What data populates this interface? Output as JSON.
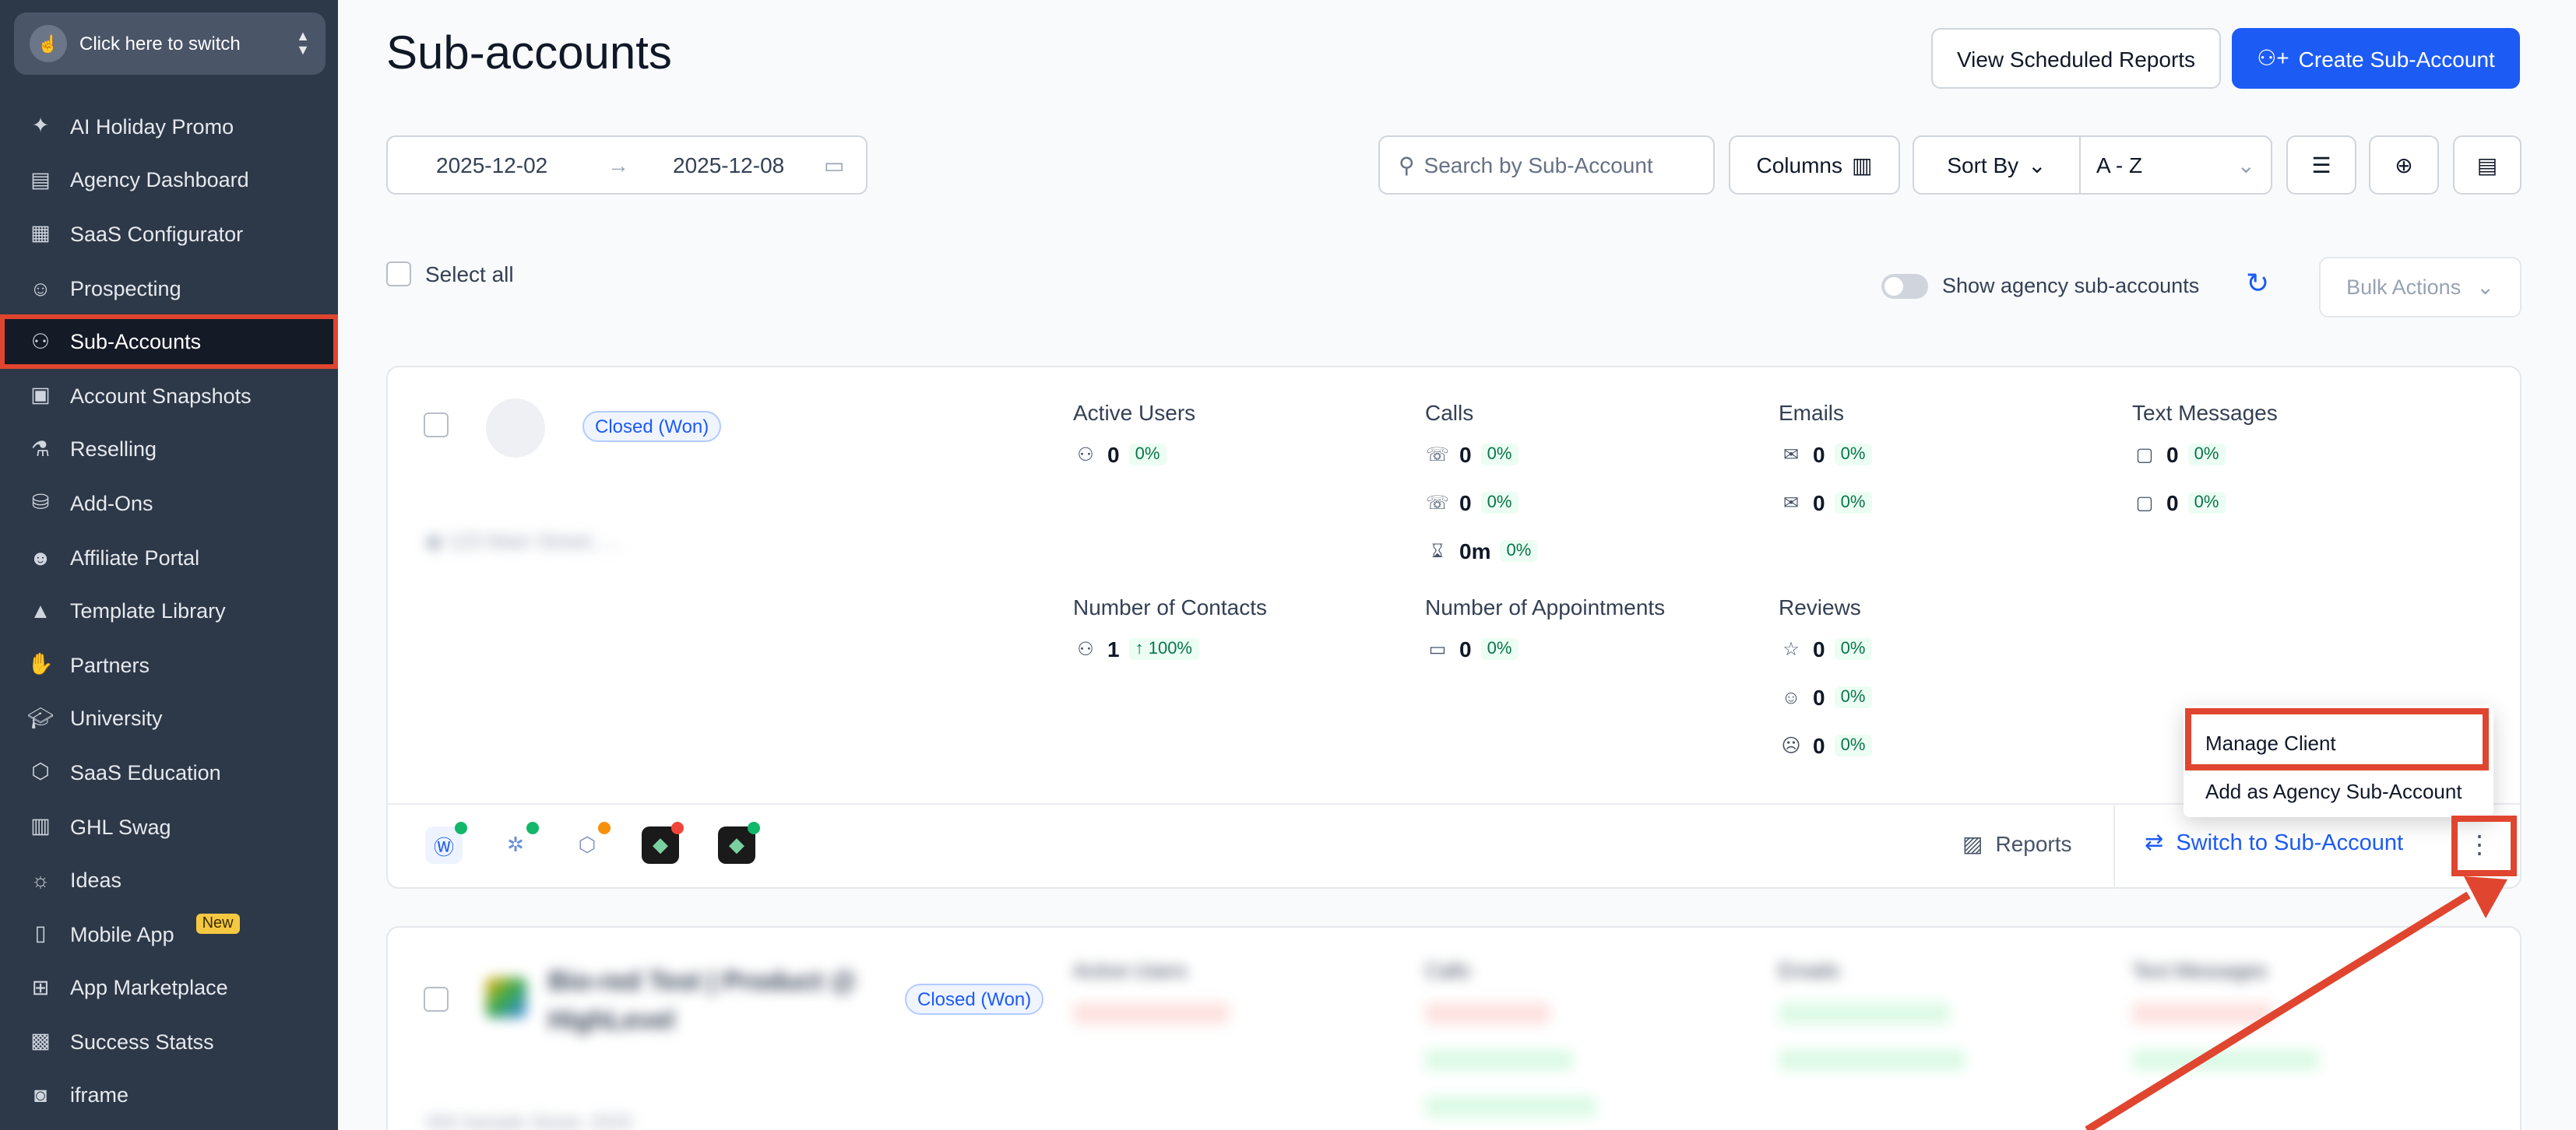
{
  "sidebar": {
    "switcher_label": "Click here to switch",
    "items": [
      {
        "label": "AI Holiday Promo",
        "icon": "sparkle-icon"
      },
      {
        "label": "Agency Dashboard",
        "icon": "dashboard-icon"
      },
      {
        "label": "SaaS Configurator",
        "icon": "chart-icon"
      },
      {
        "label": "Prospecting",
        "icon": "users-icon"
      },
      {
        "label": "Sub-Accounts",
        "icon": "user-icon"
      },
      {
        "label": "Account Snapshots",
        "icon": "snapshot-icon"
      },
      {
        "label": "Reselling",
        "icon": "reselling-icon"
      },
      {
        "label": "Add-Ons",
        "icon": "bag-icon"
      },
      {
        "label": "Affiliate Portal",
        "icon": "people-icon"
      },
      {
        "label": "Template Library",
        "icon": "shapes-icon"
      },
      {
        "label": "Partners",
        "icon": "handshake-icon"
      },
      {
        "label": "University",
        "icon": "graduation-icon"
      },
      {
        "label": "SaaS Education",
        "icon": "box-icon"
      },
      {
        "label": "GHL Swag",
        "icon": "swag-icon"
      },
      {
        "label": "Ideas",
        "icon": "bulb-icon"
      },
      {
        "label": "Mobile App",
        "icon": "phone-icon",
        "badge": "New"
      },
      {
        "label": "App Marketplace",
        "icon": "grid-icon"
      },
      {
        "label": "Success Statss",
        "icon": "stats-icon"
      },
      {
        "label": "iframe",
        "icon": "vr-icon"
      }
    ]
  },
  "header": {
    "title": "Sub-accounts",
    "view_reports": "View Scheduled Reports",
    "create": "Create Sub-Account"
  },
  "filters": {
    "date_start": "2025-12-02",
    "date_end": "2025-12-08",
    "search_placeholder": "Search by Sub-Account",
    "columns": "Columns",
    "sort_by": "Sort By",
    "sort_value": "A - Z"
  },
  "toolbar": {
    "select_all": "Select all",
    "show_agency": "Show agency sub-accounts",
    "bulk_actions": "Bulk Actions"
  },
  "card1": {
    "tag": "Closed (Won)",
    "blurred_address": "123 Main Street, ...",
    "metrics": {
      "active_users": {
        "title": "Active Users",
        "value": "0",
        "pct": "0%"
      },
      "calls": {
        "title": "Calls",
        "in": "0",
        "in_pct": "0%",
        "out": "0",
        "out_pct": "0%",
        "dur": "0m",
        "dur_pct": "0%"
      },
      "emails": {
        "title": "Emails",
        "a": "0",
        "a_pct": "0%",
        "b": "0",
        "b_pct": "0%"
      },
      "texts": {
        "title": "Text Messages",
        "a": "0",
        "a_pct": "0%",
        "b": "0",
        "b_pct": "0%"
      },
      "contacts": {
        "title": "Number of Contacts",
        "value": "1",
        "pct": "100%"
      },
      "appointments": {
        "title": "Number of Appointments",
        "value": "0",
        "pct": "0%"
      },
      "reviews": {
        "title": "Reviews",
        "a": "0",
        "a_pct": "0%",
        "b": "0",
        "b_pct": "0%",
        "c": "0",
        "c_pct": "0%"
      }
    },
    "reports": "Reports",
    "switch": "Switch to Sub-Account",
    "menu": {
      "manage": "Manage Client",
      "add_agency": "Add as Agency Sub-Account"
    }
  },
  "card2": {
    "name": "Bio-red Test | Product @ HighLevel",
    "tag": "Closed (Won)",
    "metric_titles": [
      "Active Users",
      "Calls",
      "Emails",
      "Text Messages"
    ],
    "address": "456 Sample Street, 2025"
  },
  "colors": {
    "accent": "#1d5bf5",
    "annotation": "#e0452f",
    "sidebar": "#2d3848"
  }
}
